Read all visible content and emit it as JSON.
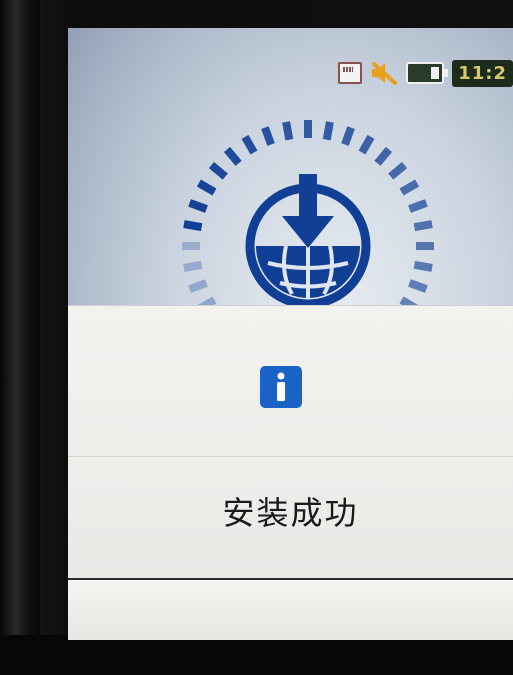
{
  "status_bar": {
    "clock": "11:2",
    "icons": [
      "sd-card-icon",
      "mute-icon",
      "battery-icon"
    ]
  },
  "install_graphic": {
    "icon": "download-globe-icon"
  },
  "dialog": {
    "icon": "info-icon",
    "message": "安装成功",
    "button_label": ""
  },
  "colors": {
    "accent_blue": "#1b63c6",
    "graphic_blue": "#123f96",
    "dialog_bg": "#eeeeeb",
    "clock_text": "#d8c96a"
  }
}
